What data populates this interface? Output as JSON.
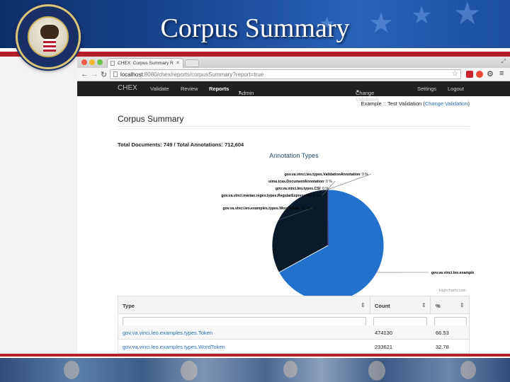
{
  "slide": {
    "title": "Corpus Summary"
  },
  "browser": {
    "tab_title": "CHEX: Corpus Summary R",
    "url_host": "localhost",
    "url_rest": ":8080/chex/reports/corpusSummary?report=true"
  },
  "appnav": {
    "brand": "CHEX",
    "items": [
      "Validate",
      "Review",
      "Reports",
      "Admin"
    ],
    "active": "Reports",
    "right_items": [
      "Change Validation",
      "Settings",
      "Logout"
    ]
  },
  "page": {
    "context_prefix": "Example :: Test Validation (",
    "context_link": "Change Validation",
    "context_suffix": ")",
    "title": "Corpus Summary",
    "totals": "Total Documents: 749 / Total Annotations: 712,604"
  },
  "chart_data": {
    "type": "pie",
    "title": "Annotation Types",
    "slices": [
      {
        "label": "gov.va.vinci.leo.examples.types.Token",
        "percent": 67,
        "color": "#2272cc"
      },
      {
        "label": "gov.va.vinci.leo.examples.types.WordToken",
        "percent": 33,
        "color": "#0b1a2b"
      },
      {
        "label": "gov.va.vinci.marian.regex.types.RegularExpression",
        "percent": 0,
        "color": "#8bbc21"
      },
      {
        "label": "gov.va.vinci.leo.types.CSI",
        "percent": 0,
        "color": "#910000"
      },
      {
        "label": "uima.tcas.DocumentAnnotation",
        "percent": 0,
        "color": "#1aadce"
      },
      {
        "label": "gov.va.vinci.leo.types.ValidationAnnotation",
        "percent": 0,
        "color": "#492970"
      }
    ],
    "label_suffix": ": ",
    "credit": "Highcharts.com"
  },
  "table": {
    "headers": [
      "Type",
      "Count",
      "%"
    ],
    "rows": [
      {
        "type": "gov.va.vinci.leo.examples.types.Token",
        "count": "474130",
        "pct": "66.53"
      },
      {
        "type": "gov.va.vinci.leo.examples.types.WordToken",
        "count": "233621",
        "pct": "32.78"
      }
    ]
  },
  "colors": {
    "banner": "#1c4d9c",
    "accent_red": "#b41f2a",
    "link": "#2a6fbb",
    "navbar": "#202020"
  }
}
